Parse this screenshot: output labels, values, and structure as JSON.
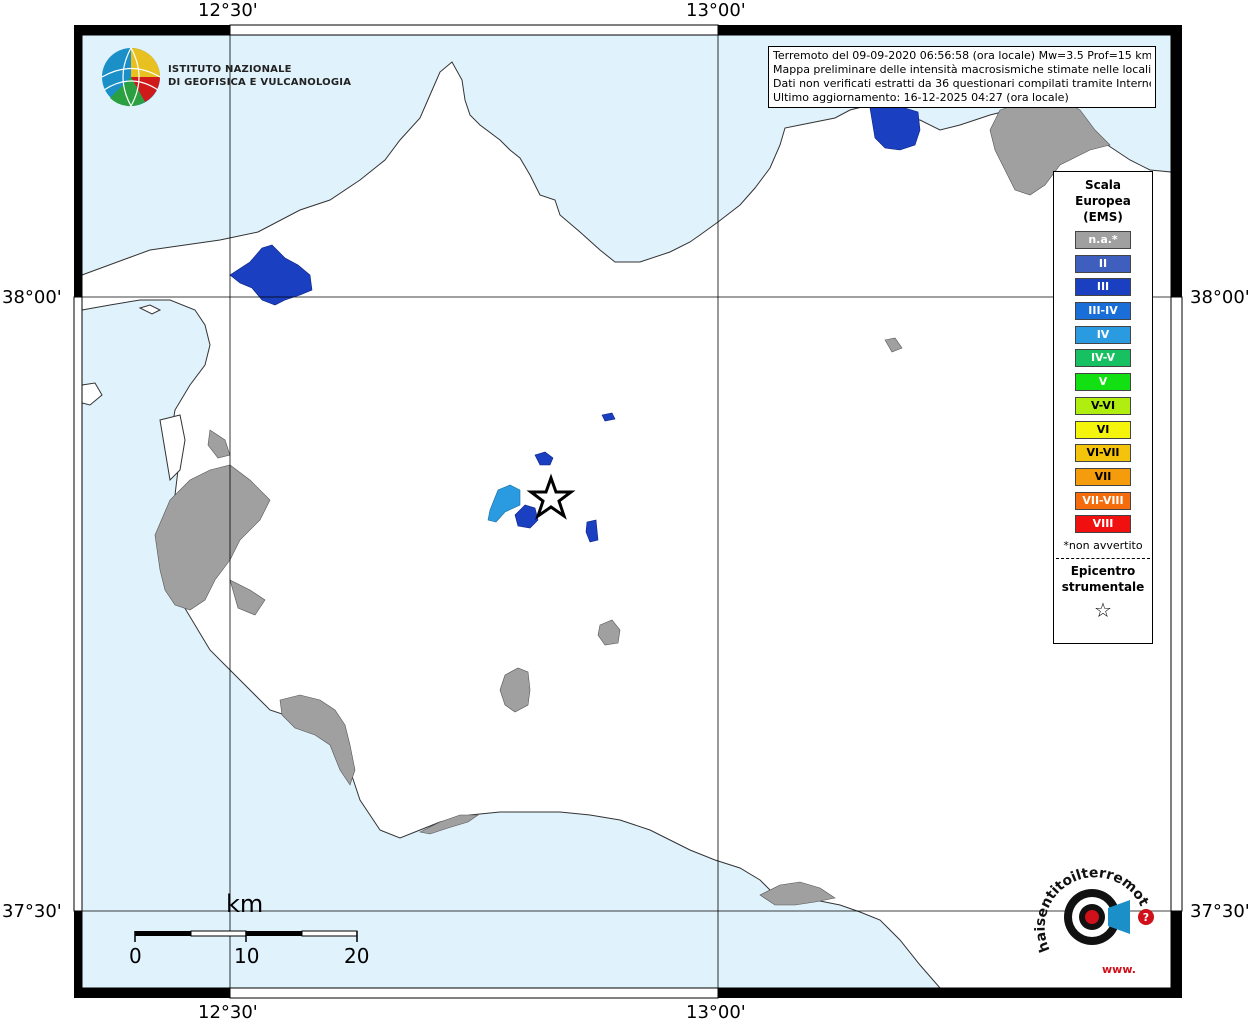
{
  "coordinates": {
    "top_left_lon": "12°30'",
    "top_right_lon": "13°00'",
    "bottom_left_lon": "12°30'",
    "bottom_right_lon": "13°00'",
    "left_lat_top": "38°00'",
    "left_lat_bottom": "37°30'",
    "right_lat_top": "38°00'",
    "right_lat_bottom": "37°30'"
  },
  "logo": {
    "line1": "ISTITUTO NAZIONALE",
    "line2": "DI GEOFISICA E VULCANOLOGIA"
  },
  "info": {
    "line1": "Terremoto del 09-09-2020 06:56:58 (ora locale) Mw=3.5 Prof=15 km",
    "line2": "Mappa preliminare delle intensità macrosismiche stimate nelle località",
    "line3": "Dati non verificati estratti da 36 questionari compilati tramite Internet.",
    "line4": "Ultimo aggiornamento: 16-12-2025 04:27 (ora locale)"
  },
  "legend": {
    "title1": "Scala",
    "title2": "Europea",
    "title3": "(EMS)",
    "items": [
      {
        "label": "n.a.*",
        "color": "#a0a0a0"
      },
      {
        "label": "II",
        "color": "#3f5fbf"
      },
      {
        "label": "III",
        "color": "#1a3fc0"
      },
      {
        "label": "III-IV",
        "color": "#1a6ed8"
      },
      {
        "label": "IV",
        "color": "#2a9be0"
      },
      {
        "label": "IV-V",
        "color": "#17c060"
      },
      {
        "label": "V",
        "color": "#12e012"
      },
      {
        "label": "V-VI",
        "color": "#b0ee10"
      },
      {
        "label": "VI",
        "color": "#f4f40c"
      },
      {
        "label": "VI-VII",
        "color": "#f4c40c"
      },
      {
        "label": "VII",
        "color": "#f49c0c"
      },
      {
        "label": "VII-VIII",
        "color": "#f46c0c"
      },
      {
        "label": "VIII",
        "color": "#f01010"
      }
    ],
    "note": "*non avvertito",
    "epi1": "Epicentro",
    "epi2": "strumentale",
    "star": "☆"
  },
  "scale": {
    "unit": "km",
    "tick0": "0",
    "tick1": "10",
    "tick2": "20"
  },
  "watermark": {
    "text": "haisentitoilterremoto.it",
    "url": "www."
  },
  "colors": {
    "sea": "#e0f2fc",
    "land": "#ffffff",
    "na": "#a0a0a0",
    "ii": "#3f5fbf",
    "iii": "#1a3fc0",
    "iv": "#2a9be0",
    "watermark_red": "#d0101a"
  }
}
